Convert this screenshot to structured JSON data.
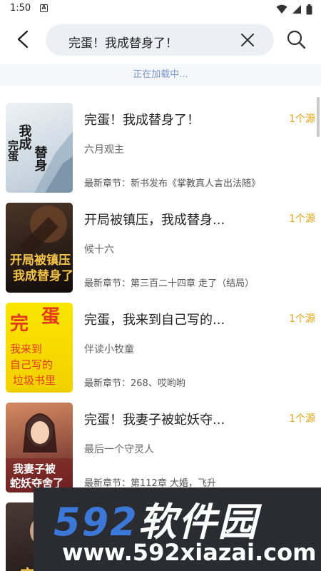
{
  "status_bar": {
    "time": "1:50",
    "notification_glyph": "A",
    "icons": [
      "wifi-icon",
      "signal-icon",
      "battery-icon"
    ]
  },
  "search": {
    "query": "完蛋！我成替身了！"
  },
  "loading_text": "正在加载中...",
  "results": [
    {
      "title": "完蛋！我成替身了！",
      "author": "六月观主",
      "latest": "最新章节：新书发布《掌教真人言出法随》",
      "sources": "1个源",
      "cover": {
        "colors": [
          "#e7edf2",
          "#b9c9d6"
        ],
        "text": "我成替身了",
        "text_color": "#1a1a1a"
      }
    },
    {
      "title": "开局被镇压，我成替身...",
      "author": "候十六",
      "latest": "最新章节：第三百二十四章 走了（结局）",
      "sources": "1个源",
      "cover": {
        "colors": [
          "#3a2a22",
          "#120d0b"
        ],
        "text": "开局被镇压",
        "text_color": "#f3c44a"
      }
    },
    {
      "title": "完蛋，我来到自己写的...",
      "author": "伴读小牧童",
      "latest": "最新章节：268、哎哟哟",
      "sources": "1个源",
      "cover": {
        "colors": [
          "#f9e300",
          "#f3d200"
        ],
        "text": "完蛋",
        "text_color": "#e43a1a"
      }
    },
    {
      "title": "完蛋！我妻子被蛇妖夺...",
      "author": "最后一个守灵人",
      "latest": "最新章节：第112章 大婚，飞升",
      "sources": "1个源",
      "cover": {
        "colors": [
          "#c46a4a",
          "#5a1f22"
        ],
        "text": "我妻子被蛇妖夺舍了",
        "text_color": "#ffffff"
      }
    },
    {
      "title": "",
      "author": "",
      "latest": "",
      "sources": "",
      "cover": {
        "colors": [
          "#3a2f2a",
          "#1b1414"
        ],
        "text": "完",
        "text_color": "#f3c44a"
      }
    }
  ],
  "watermark": {
    "numbers": "592",
    "brand": "软件园",
    "url": "www.592xiazai.com"
  }
}
